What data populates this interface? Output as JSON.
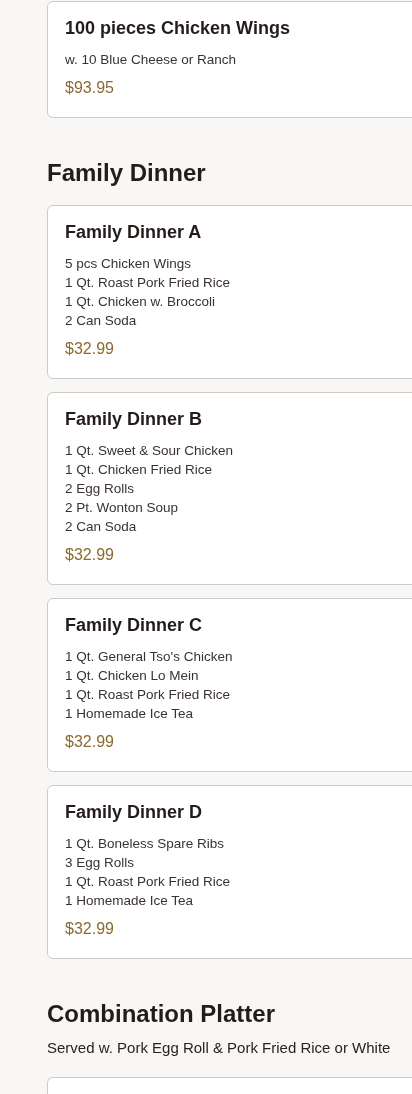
{
  "sections": [
    {
      "items": [
        {
          "kind": "full",
          "name": "100 pieces Chicken Wings",
          "lines": [
            "w. 10 Blue Cheese or Ranch"
          ],
          "price": "$93.95"
        }
      ]
    },
    {
      "title": "Family Dinner",
      "items": [
        {
          "kind": "full",
          "name": "Family Dinner A",
          "lines": [
            "5 pcs Chicken Wings",
            "1 Qt. Roast Pork Fried Rice",
            "1 Qt. Chicken w. Broccoli",
            "2 Can Soda"
          ],
          "price": "$32.99"
        },
        {
          "kind": "full",
          "name": "Family Dinner B",
          "lines": [
            "1 Qt. Sweet & Sour Chicken",
            "1 Qt. Chicken Fried Rice",
            "2 Egg Rolls",
            "2 Pt. Wonton Soup",
            "2 Can Soda"
          ],
          "price": "$32.99"
        },
        {
          "kind": "full",
          "name": "Family Dinner C",
          "lines": [
            "1 Qt. General Tso's Chicken",
            "1 Qt. Chicken Lo Mein",
            "1 Qt. Roast Pork Fried Rice",
            "1 Homemade Ice Tea"
          ],
          "price": "$32.99"
        },
        {
          "kind": "full",
          "name": "Family Dinner D",
          "lines": [
            "1 Qt. Boneless Spare Ribs",
            "3 Egg Rolls",
            "1 Qt. Roast Pork Fried Rice",
            "1 Homemade Ice Tea"
          ],
          "price": "$32.99"
        }
      ]
    },
    {
      "title": "Combination Platter",
      "note": "Served w. Pork Egg Roll & Pork Fried Rice or White",
      "items": [
        {
          "kind": "partial"
        }
      ]
    }
  ]
}
